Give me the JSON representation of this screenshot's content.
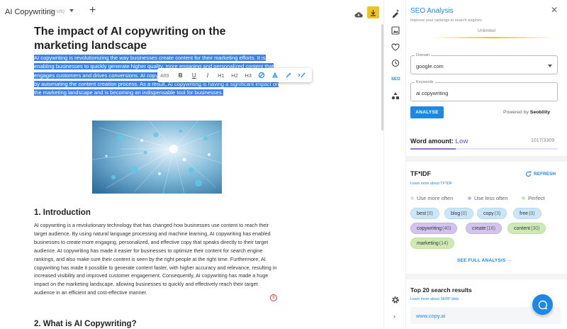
{
  "header": {
    "doc_title": "AI Copywriting",
    "language": "(EN-US)"
  },
  "editor": {
    "title": "The impact of AI copywriting on the marketing landscape",
    "selected_paragraph": "AI copywriting is revolutionizing the way businesses create content for their marketing efforts. It is enabling businesses to quickly generate higher quality, more engaging and personalized content that engages customers and drives conversions. AI copywriting is helping marketers save time and money by automating the content creation process. As a result, AI copywriting is having a significant impact on the marketing landscape and is becoming an indispensable tool for businesses.",
    "toolbar": {
      "word_count": "489",
      "bold": "B",
      "underline": "U",
      "italic": "I",
      "h1": "H1",
      "h2": "H2",
      "h3": "H3"
    },
    "section1_heading": "1. Introduction",
    "section1_text": "AI copywriting is a revolutionary technology that has changed how businesses use content to reach their target audience. By using natural language processing and machine learning, AI copywriting has enabled businesses to create more engaging, personalized, and effective copy that speaks directly to their target audience. AI copywriting has made it easier for businesses to optimize their content for search engine rankings, and also make sure their content is seen by the right people at the right time. Furthermore, AI copywriting has made it possible to generate content faster, with higher accuracy and relevance, resulting in increased visibility and improved customer engagement. Consequently, AI copywriting has made a huge impact on the marketing landscape, allowing businesses to quickly and effectively reach their target audience in an efficient and cost-effective manner.",
    "section2_heading": "2. What is AI Copywriting?",
    "issue_badge": "6"
  },
  "rail": {
    "seo_label": "SEO"
  },
  "seo": {
    "title": "SEO Analysis",
    "subtitle": "Improve your rankings in search engines",
    "plan": "Unlimited",
    "domain_label": "Domain",
    "domain_value": "google.com",
    "keywords_label": "Keywords",
    "keywords_value": "ai copywriting",
    "analyse_label": "ANALYSE",
    "powered_prefix": "Powered by",
    "powered_brand": "Seobility",
    "word_amount_label": "Word amount:",
    "word_amount_status": "Low",
    "word_amount_count": "1017/3309",
    "word_amount_progress": 0.307,
    "tfidf_title": "TF*IDF",
    "tfidf_link": "Learn more about TF*IDF",
    "refresh_label": "REFRESH",
    "legend": {
      "more": "Use more often",
      "less": "Use less often",
      "perfect": "Perfect"
    },
    "terms": [
      {
        "word": "best",
        "count": "(0)",
        "kind": "blue"
      },
      {
        "word": "blog",
        "count": "(0)",
        "kind": "blue"
      },
      {
        "word": "copy",
        "count": "(3)",
        "kind": "blue"
      },
      {
        "word": "free",
        "count": "(0)",
        "kind": "blue"
      },
      {
        "word": "copywriting",
        "count": "(40)",
        "kind": "purple"
      },
      {
        "word": "create",
        "count": "(16)",
        "kind": "purple"
      },
      {
        "word": "content",
        "count": "(30)",
        "kind": "green"
      },
      {
        "word": "marketing",
        "count": "(14)",
        "kind": "green"
      }
    ],
    "full_analysis": "SEE FULL ANALYSIS",
    "serp_title": "Top 20 search results",
    "serp_link": "Learn more about SERP data",
    "serp_first": "www.copy.ai"
  },
  "colors": {
    "accent": "#1e88e5",
    "selection": "#3d82e6",
    "warning": "#f2c21b",
    "low": "#9575cd"
  }
}
